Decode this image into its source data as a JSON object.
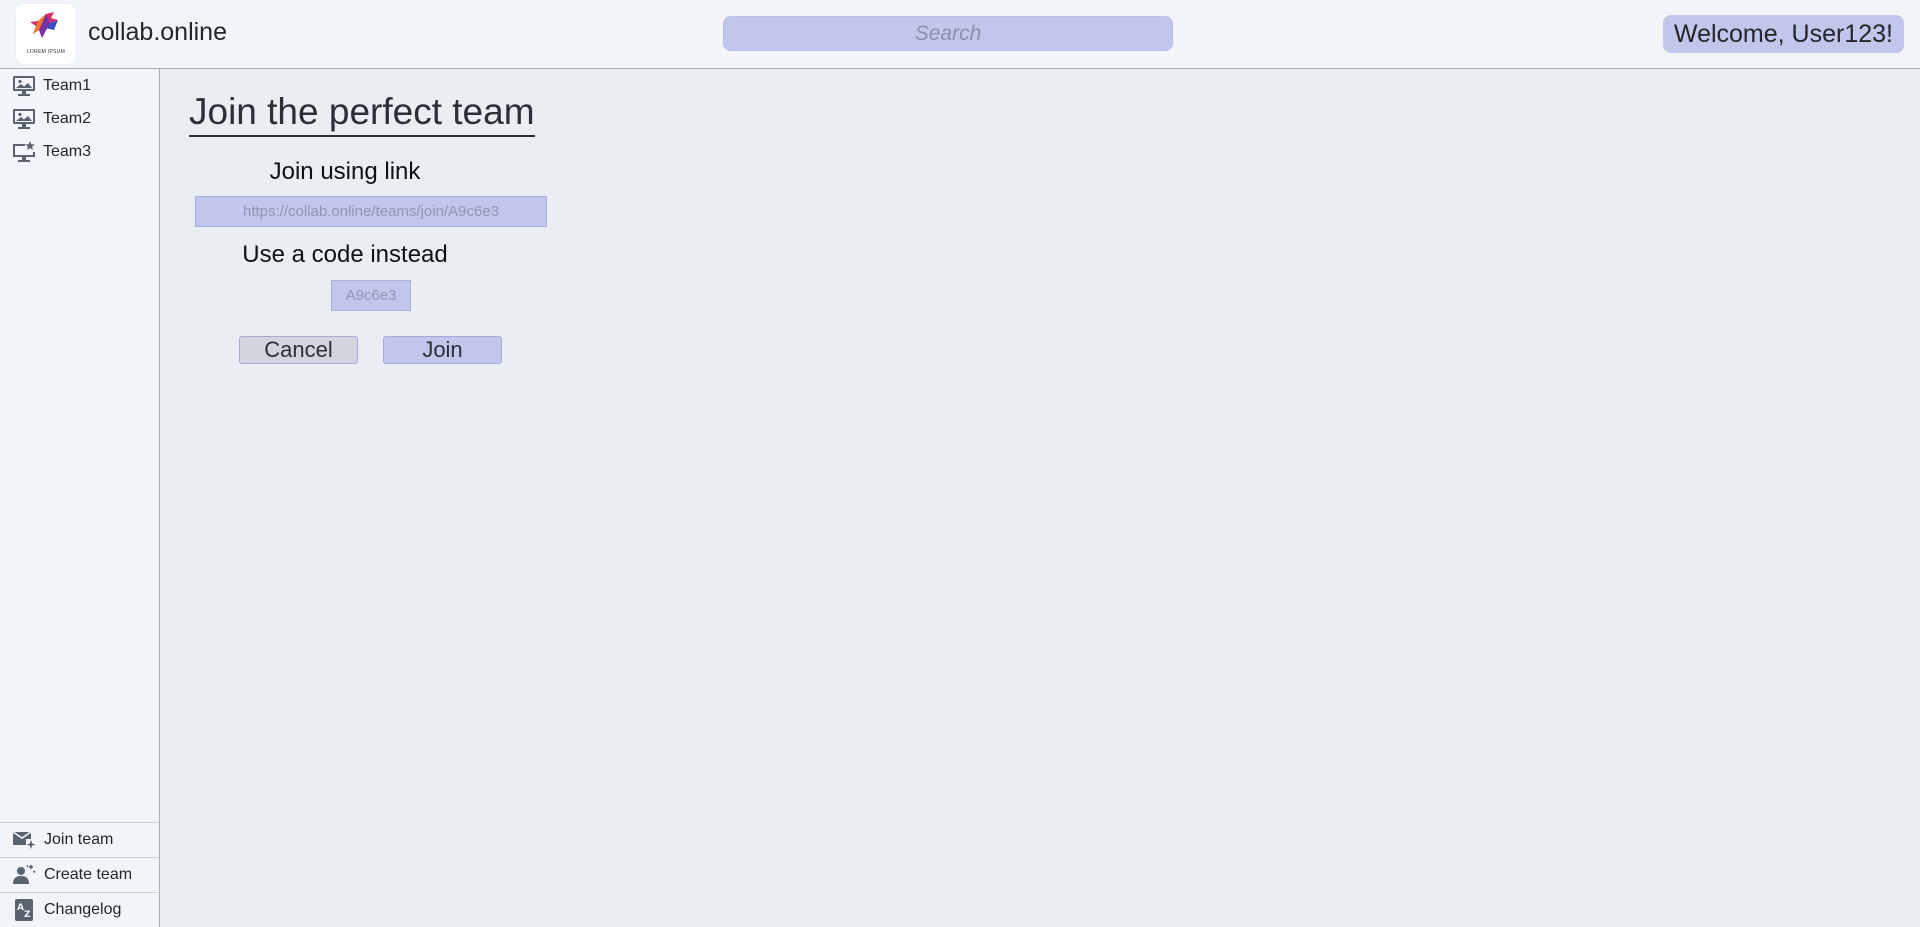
{
  "header": {
    "app_title": "collab.online",
    "logo_caption": "LOREM IPSUM",
    "search_placeholder": "Search",
    "welcome_text": "Welcome, User123!"
  },
  "sidebar": {
    "teams": [
      {
        "label": "Team1",
        "icon": "monitor-image-icon"
      },
      {
        "label": "Team2",
        "icon": "monitor-image-icon"
      },
      {
        "label": "Team3",
        "icon": "monitor-star-icon"
      }
    ],
    "bottom": [
      {
        "label": "Join team",
        "icon": "mail-sparkle-icon"
      },
      {
        "label": "Create team",
        "icon": "person-sparkle-icon"
      },
      {
        "label": "Changelog",
        "icon": "az-list-icon"
      }
    ]
  },
  "main": {
    "title": "Join the perfect team",
    "link_label": "Join using link",
    "link_placeholder": "https://collab.online/teams/join/A9c6e3",
    "code_label": "Use a code instead",
    "code_placeholder": "A9c6e3",
    "cancel_label": "Cancel",
    "join_label": "Join"
  },
  "colors": {
    "accent": "#c1c7ea",
    "header_bg": "#f1f5f9",
    "page_bg": "#e9eef3",
    "border": "#9fb1b6",
    "icon": "#5a6470"
  }
}
